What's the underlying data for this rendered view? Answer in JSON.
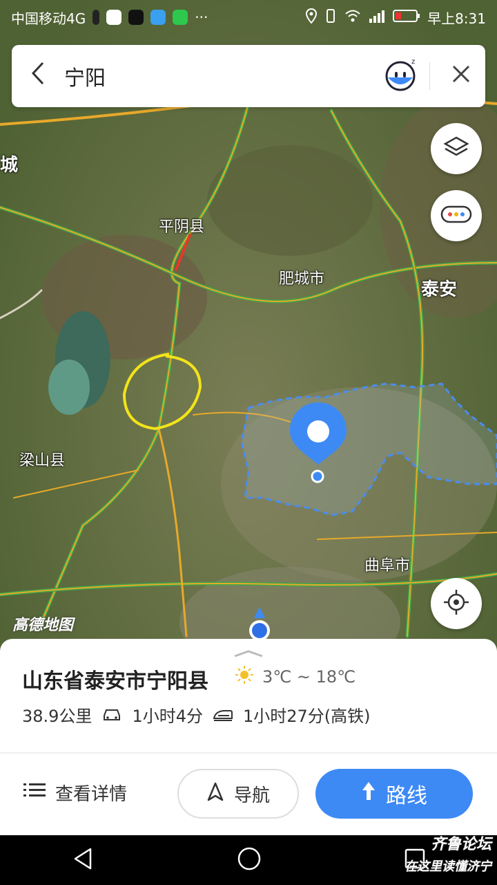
{
  "status_bar": {
    "carrier": "中国移动4G",
    "time": "早上8:31"
  },
  "search": {
    "back_icon": "chevron-left-icon",
    "query": "宁阳",
    "assistant_icon": "voice-assistant-icon",
    "close_icon": "close-icon"
  },
  "map": {
    "labels": {
      "cheng": "城",
      "pingyin": "平阴县",
      "feicheng": "肥城市",
      "taian": "泰安",
      "liangshan": "梁山县",
      "qufu": "曲阜市"
    },
    "brand": "高德地图",
    "controls": {
      "layers_icon": "layers-icon",
      "more_icon": "more-dots-icon",
      "locate_icon": "locate-icon"
    }
  },
  "place": {
    "title": "山东省泰安市宁阳县",
    "weather": "3℃ ~ 18℃",
    "distance": "38.9公里",
    "drive_time": "1小时4分",
    "train_time": "1小时27分(高铁)"
  },
  "actions": {
    "details": "查看详情",
    "navigate": "导航",
    "route": "路线"
  },
  "watermark": {
    "line1": "齐鲁论坛",
    "line2": "在这里读懂济宁"
  },
  "colors": {
    "accent": "#3d8af5",
    "road": "#e8a92a",
    "road_green": "#3ea84a",
    "highlight_circle": "#f3e31a"
  }
}
